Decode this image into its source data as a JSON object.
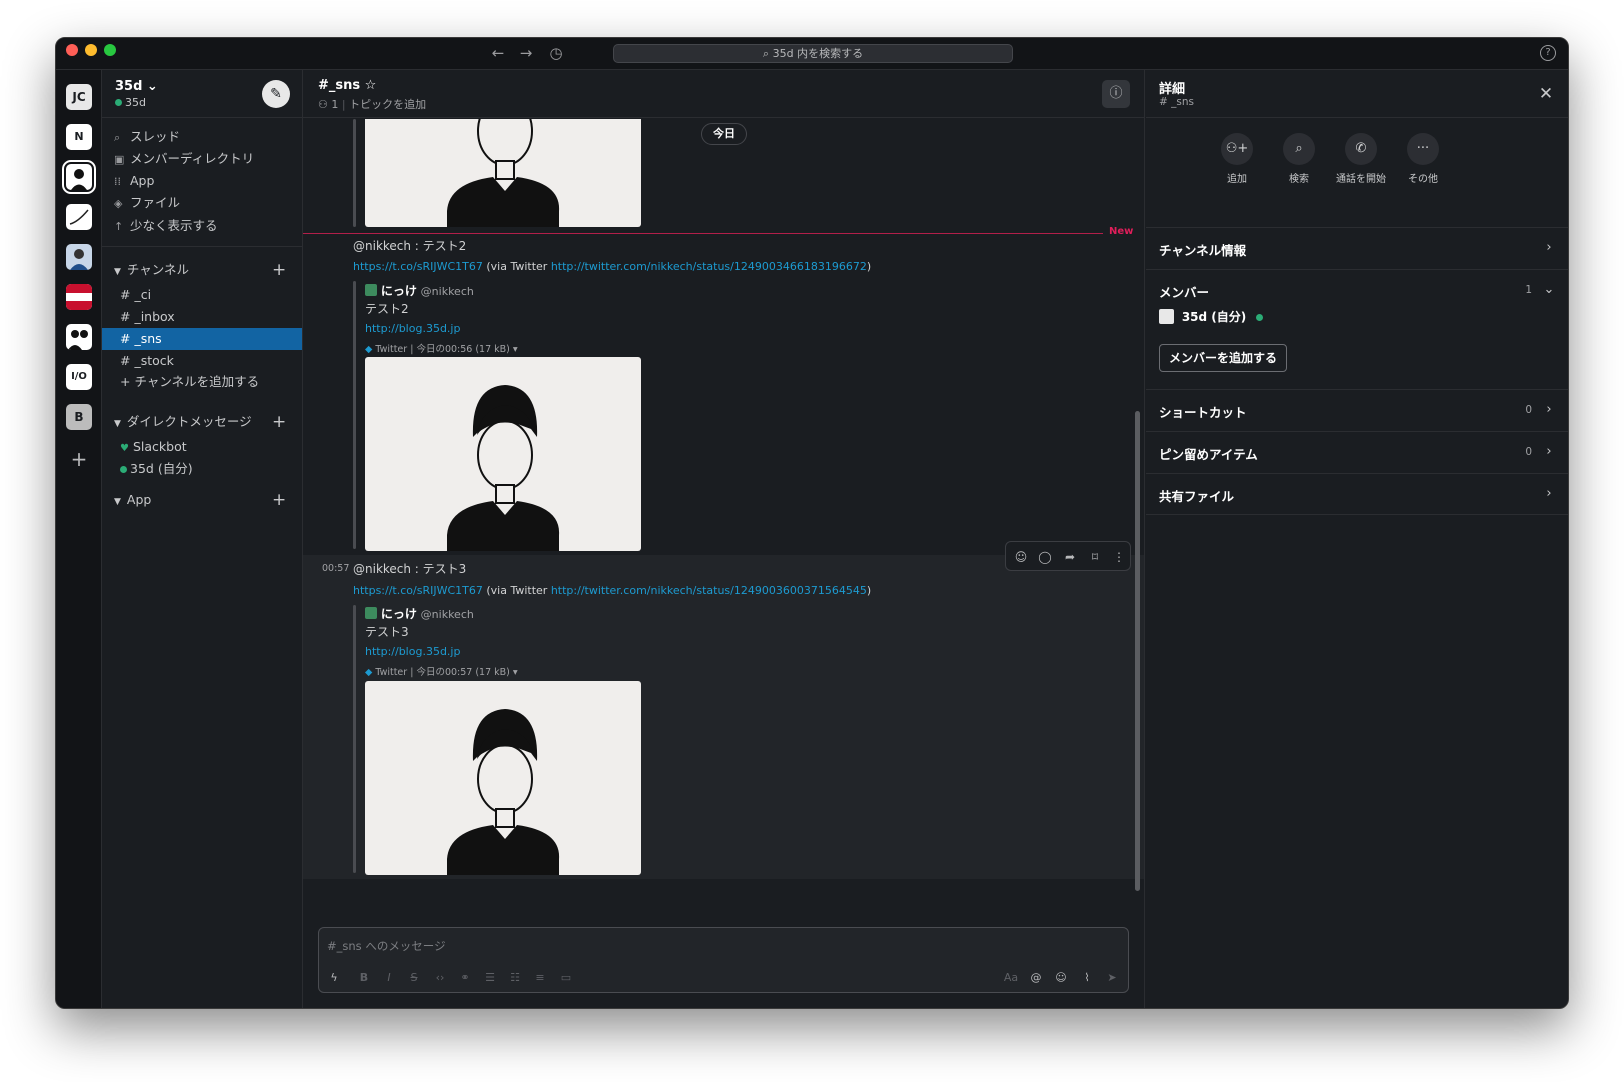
{
  "titlebar": {
    "search_placeholder": "35d 内を検索する"
  },
  "rail": {
    "workspaces": [
      "JC",
      "N",
      "",
      "",
      "",
      "",
      "",
      "I/O",
      "B"
    ]
  },
  "sidebar": {
    "workspace_name": "35d ⌄",
    "user": "35d",
    "nav": [
      "スレッド",
      "メンバーディレクトリ",
      "App",
      "ファイル",
      "少なく表示する"
    ],
    "channels_label": "チャンネル",
    "channels": [
      "# _ci",
      "# _inbox",
      "# _sns",
      "# _stock"
    ],
    "add_channel": "+ チャンネルを追加する",
    "dm_label": "ダイレクトメッセージ",
    "dms": [
      "Slackbot",
      "35d (自分)"
    ],
    "app_label": "App"
  },
  "channel": {
    "title": "#_sns ☆",
    "members": "1",
    "topic": "トピックを追加",
    "date_pill": "今日",
    "new_label": "New",
    "messages": [
      {
        "time": "",
        "text": "@nikkech : テスト2",
        "short_link": "https://t.co/sRIJWC1T67",
        "via": "(via Twitter",
        "long_link": "http://twitter.com/nikkech/status/1249003466183196672",
        "close": ")",
        "author": "にっけ",
        "handle": "@nikkech",
        "quote_text": "テスト2",
        "blog": "http://blog.35d.jp",
        "source": "Twitter",
        "meta": "| 今日の00:56 (17 kB) ▾"
      },
      {
        "time": "00:57",
        "text": "@nikkech : テスト3",
        "short_link": "https://t.co/sRIJWC1T67",
        "via": "(via Twitter",
        "long_link": "http://twitter.com/nikkech/status/1249003600371564545",
        "close": ")",
        "author": "にっけ",
        "handle": "@nikkech",
        "quote_text": "テスト3",
        "blog": "http://blog.35d.jp",
        "source": "Twitter",
        "meta": "| 今日の00:57 (17 kB) ▾"
      }
    ],
    "composer_placeholder": "#_sns へのメッセージ"
  },
  "details": {
    "title": "詳細",
    "subtitle": "# _sns",
    "actions": [
      "追加",
      "検索",
      "通話を開始",
      "その他"
    ],
    "channel_info": "チャンネル情報",
    "members_label": "メンバー",
    "members_count": "1",
    "member_name": "35d (自分)",
    "add_member": "メンバーを追加する",
    "shortcuts": "ショートカット",
    "shortcuts_count": "0",
    "pins": "ピン留めアイテム",
    "pins_count": "0",
    "files": "共有ファイル"
  },
  "colors": {
    "accent": "#1264a3",
    "link": "#1d9bd1",
    "new": "#e01e5a",
    "online": "#2bac76"
  }
}
